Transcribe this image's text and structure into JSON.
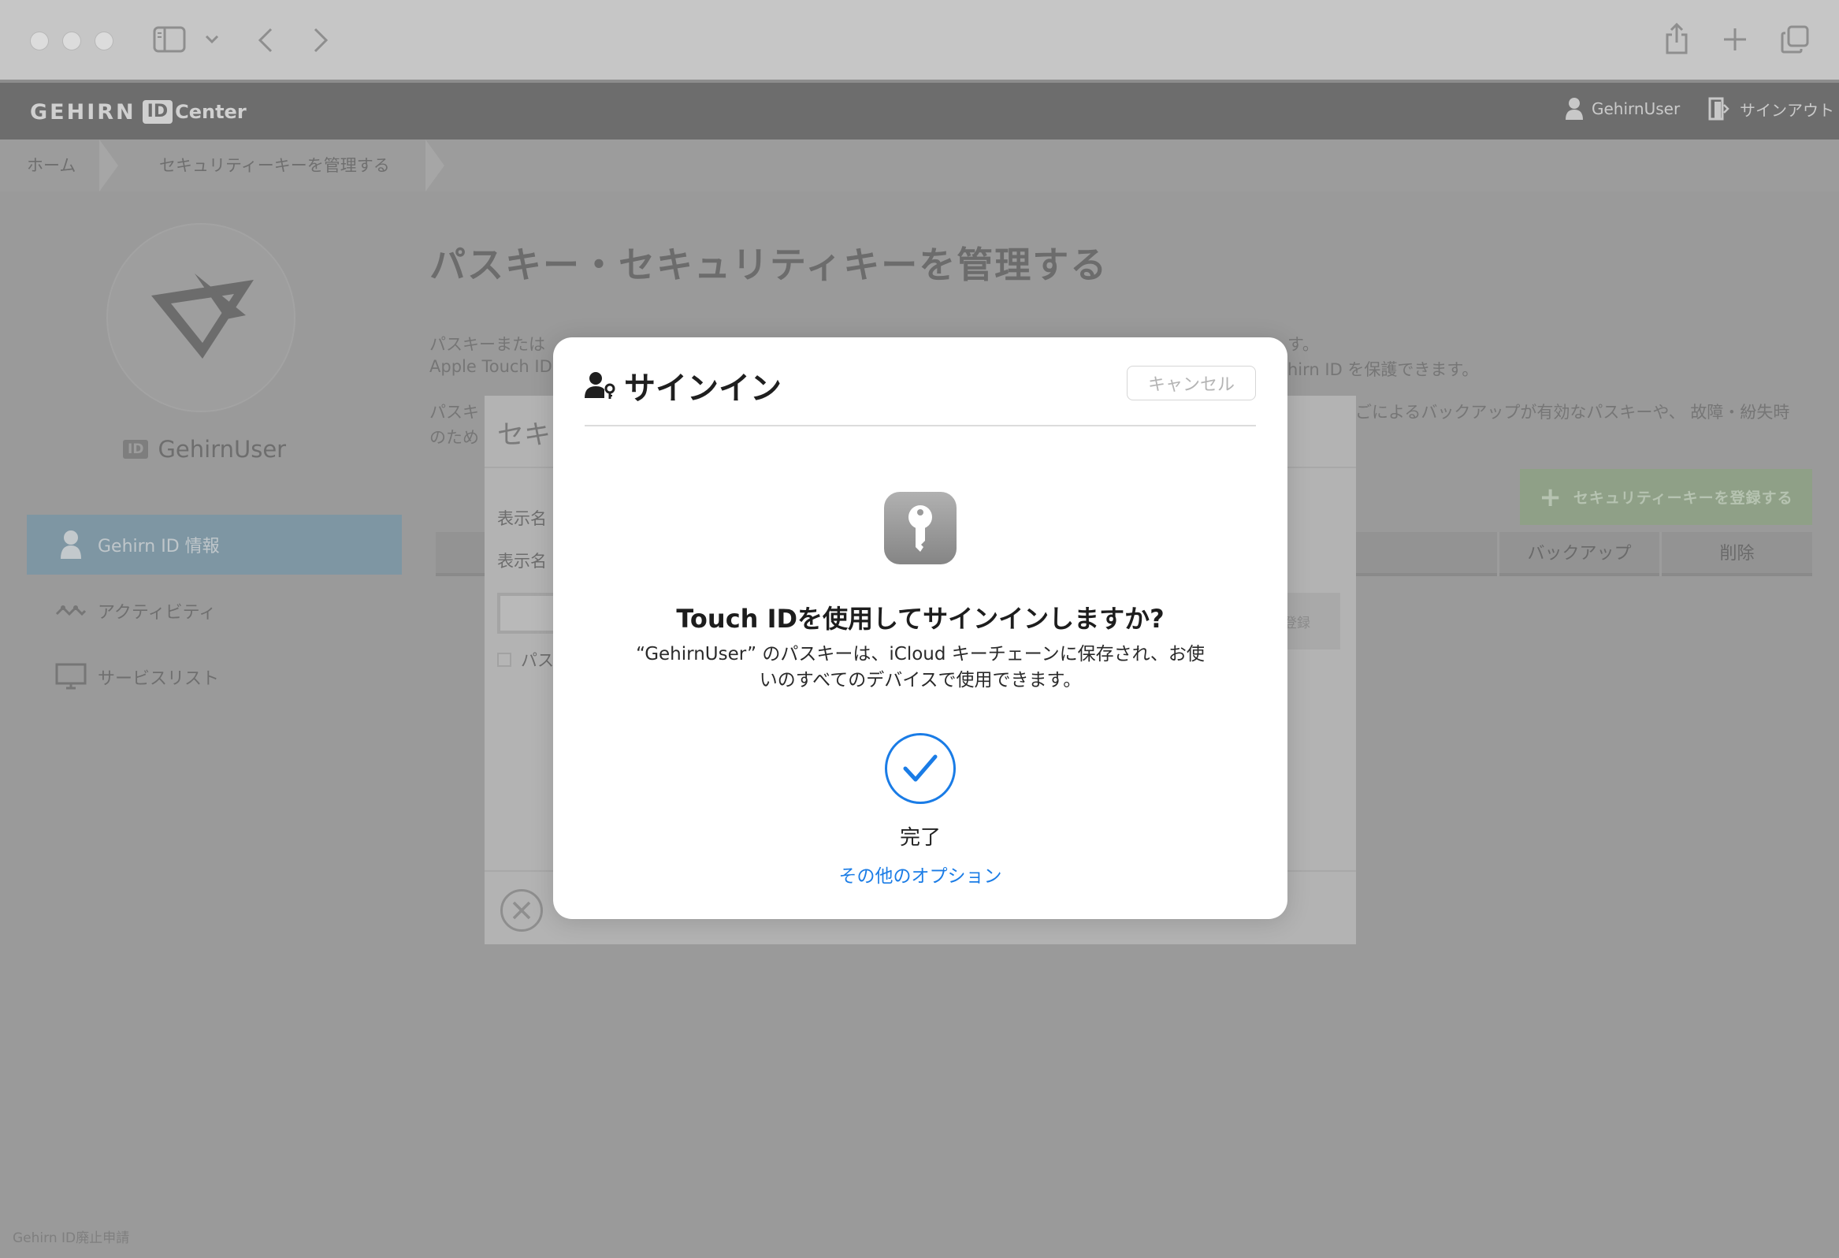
{
  "browser": {
    "icons": [
      "sidebar-icon",
      "chevron-down-icon",
      "back-icon",
      "forward-icon",
      "share-icon",
      "new-tab-icon",
      "tabs-overview-icon"
    ]
  },
  "header": {
    "logo_word": "GEHIRN",
    "logo_id": "ID",
    "logo_center": "Center",
    "username": "GehirnUser",
    "signout": "サインアウト"
  },
  "breadcrumb": {
    "home": "ホーム",
    "current": "セキュリティーキーを管理する"
  },
  "sidebar": {
    "user_badge": "ID",
    "username": "GehirnUser",
    "items": [
      {
        "label": "Gehirn ID 情報",
        "icon": "person-icon"
      },
      {
        "label": "アクティビティ",
        "icon": "activity-icon"
      },
      {
        "label": "サービスリスト",
        "icon": "monitor-icon"
      }
    ],
    "footer_link": "Gehirn ID廃止申請"
  },
  "main": {
    "title": "パスキー・セキュリティキーを管理する",
    "para1_line1_start": "パスキーまたは",
    "para1_line1_end": "す。",
    "para1_line2_start": "Apple Touch ID",
    "para1_line2_end": "hirn ID を保護できます。",
    "para2_line1_start": "パスキ",
    "para2_line1_end": "ごによるバックアップが有効なパスキーや、 故障・紛失時",
    "para2_line2_start": "のため",
    "register_button": "セキュリティーキーを登録する",
    "table": {
      "col_backup": "バックアップ",
      "col_delete": "削除"
    }
  },
  "under_modal": {
    "title": "セキ",
    "label1": "表示名",
    "label2": "表示名",
    "register": "登録",
    "checkbox_label": "パス"
  },
  "passkey_sheet": {
    "title": "サインイン",
    "cancel": "キャンセル",
    "heading": "Touch IDを使用してサインインしますか?",
    "desc_line1": "“GehirnUser” のパスキーは、iCloud キーチェーンに保存され、お使",
    "desc_line2": "いのすべてのデバイスで使用できます。",
    "done": "完了",
    "other_options": "その他のオプション",
    "accent_color": "#1a7ce6"
  }
}
